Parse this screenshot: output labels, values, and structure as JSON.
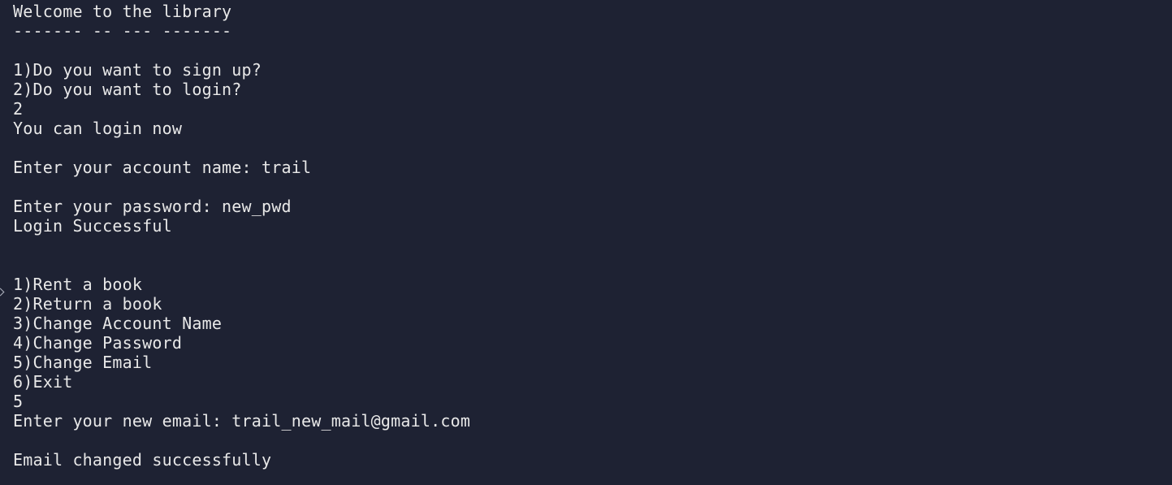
{
  "terminal": {
    "lines": [
      "Welcome to the library",
      "------- -- --- -------",
      "",
      "1)Do you want to sign up?",
      "2)Do you want to login?",
      "2",
      "You can login now",
      "",
      "Enter your account name: trail",
      "",
      "Enter your password: new_pwd",
      "Login Successful",
      "",
      "",
      "1)Rent a book",
      "2)Return a book",
      "3)Change Account Name",
      "4)Change Password",
      "5)Change Email",
      "6)Exit",
      "5",
      "Enter your new email: trail_new_mail@gmail.com",
      "",
      "Email changed successfully"
    ],
    "colors": {
      "background": "#1e2233",
      "foreground": "#e8e8e8"
    }
  }
}
